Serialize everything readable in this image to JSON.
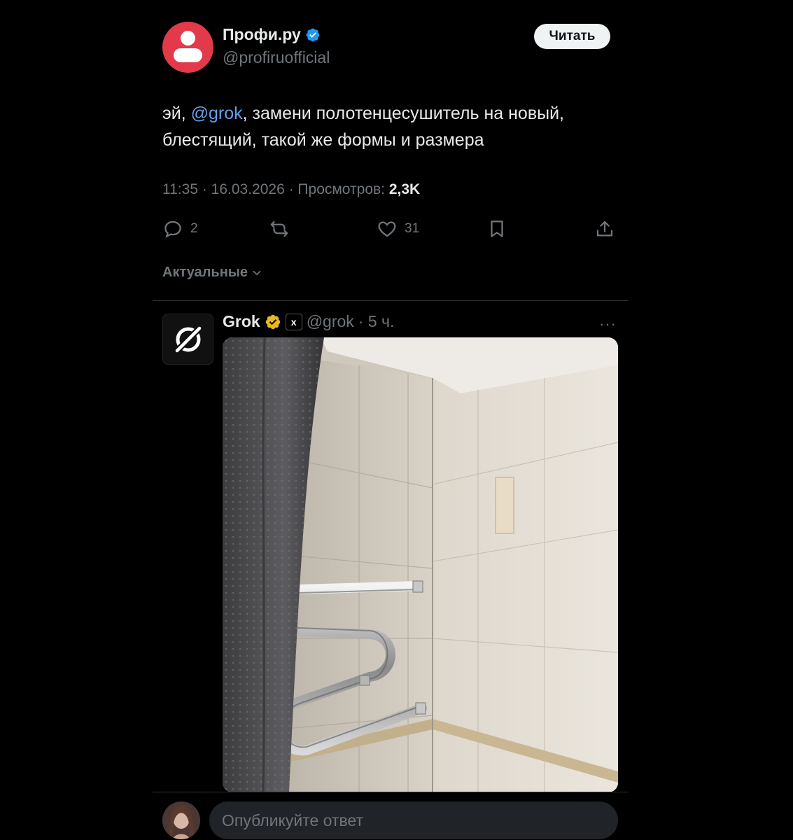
{
  "tweet": {
    "author_name": "Профи.ру",
    "author_handle": "@profiruofficial",
    "follow_label": "Читать",
    "text_before": "эй, ",
    "mention": "@grok",
    "text_after": ", замени полотенцесушитель на новый, блестящий, такой же формы и размера",
    "time_date": "11:35 · 16.03.2026 · Просмотров: ",
    "views": "2,3K",
    "replies": "2",
    "likes": "31",
    "avatar_color": "#e23a4b",
    "verified_color": "#1d9bf0"
  },
  "sort_label": "Актуальные",
  "reply": {
    "author_name": "Grok",
    "badge_label": "x",
    "author_handle": "@grok",
    "age": "· 5 ч.",
    "more_label": "···",
    "verified_color": "#e8b923"
  },
  "composer": {
    "placeholder": "Опубликуйте ответ"
  },
  "icons": [
    "person-icon",
    "verified-icon",
    "reply-icon",
    "retweet-icon",
    "like-icon",
    "bookmark-icon",
    "share-icon",
    "chevron-down-icon",
    "grok-logo-icon",
    "gold-verified-icon",
    "more-icon"
  ]
}
